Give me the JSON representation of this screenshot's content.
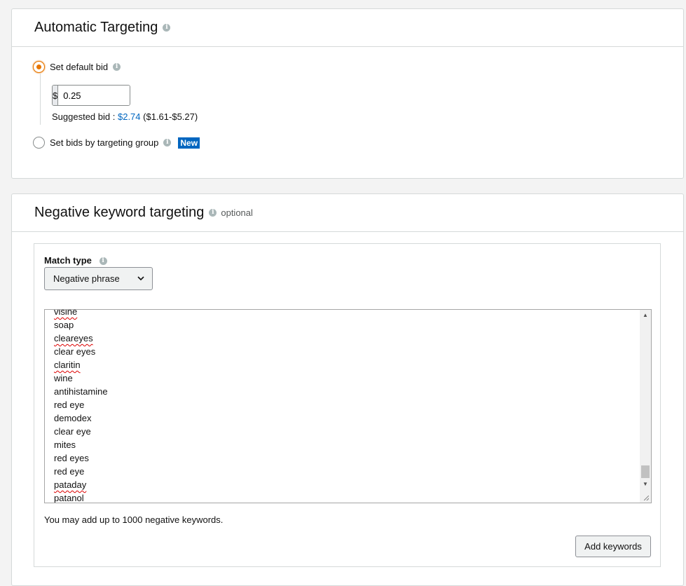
{
  "automatic_targeting": {
    "title": "Automatic Targeting",
    "default_bid_label": "Set default bid",
    "bid_currency": "$",
    "bid_value": "0.25",
    "suggested_label": "Suggested bid :",
    "suggested_value": "$2.74",
    "suggested_range": "($1.61-$5.27)",
    "group_bid_label": "Set bids by targeting group",
    "new_badge": "New"
  },
  "negative_keyword_targeting": {
    "title": "Negative keyword targeting",
    "optional": "optional",
    "match_type_label": "Match type",
    "match_type_value": "Negative phrase",
    "keywords": [
      {
        "text": "visine",
        "spell": true
      },
      {
        "text": "soap",
        "spell": false
      },
      {
        "text": "cleareyes",
        "spell": true
      },
      {
        "text": "clear eyes",
        "spell": false
      },
      {
        "text": "claritin",
        "spell": true
      },
      {
        "text": "wine",
        "spell": false
      },
      {
        "text": "antihistamine",
        "spell": false
      },
      {
        "text": "red eye",
        "spell": false
      },
      {
        "text": "demodex",
        "spell": false
      },
      {
        "text": "clear eye",
        "spell": false
      },
      {
        "text": "mites",
        "spell": false
      },
      {
        "text": "red eyes",
        "spell": false
      },
      {
        "text": "red eye",
        "spell": false
      },
      {
        "text": "pataday",
        "spell": true
      },
      {
        "text": "patanol",
        "spell": true
      }
    ],
    "limit_text": "You may add up to 1000 negative keywords.",
    "add_button": "Add keywords"
  }
}
